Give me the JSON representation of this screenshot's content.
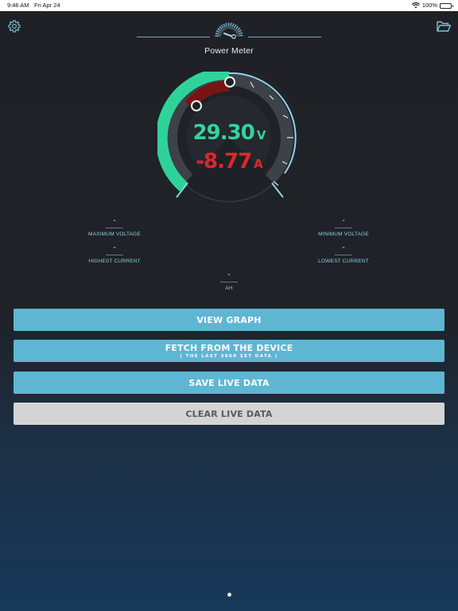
{
  "status_bar": {
    "time": "9:46 AM",
    "date": "Fri Apr 24",
    "battery": "100%"
  },
  "header": {
    "title": "Power Meter"
  },
  "gauge": {
    "voltage_value": "29.30",
    "voltage_unit": "V",
    "current_value": "-8.77",
    "current_unit": "A",
    "accent_color": "#34d399",
    "warning_color": "#e0262b"
  },
  "stats": {
    "max_voltage": {
      "value": "-",
      "label": "MAXIMUM VOLTAGE"
    },
    "min_voltage": {
      "value": "-",
      "label": "MINIMUM VOLTAGE"
    },
    "highest_current": {
      "value": "-",
      "label": "HIGHEST CURRENT"
    },
    "lowest_current": {
      "value": "-",
      "label": "LOWEST CURRENT"
    },
    "ah": {
      "value": "-",
      "label": "AH"
    }
  },
  "buttons": {
    "view_graph": "VIEW GRAPH",
    "fetch": "FETCH FROM THE DEVICE",
    "fetch_sub": "( THE LAST 3600 SET DATA )",
    "save": "SAVE LIVE DATA",
    "clear": "CLEAR LIVE DATA"
  },
  "icons": {
    "settings": "gear-icon",
    "folder": "folder-open-icon",
    "logo": "speedometer-icon"
  },
  "colors": {
    "button": "#5fb6d3",
    "button_disabled": "#d4d4d4"
  }
}
